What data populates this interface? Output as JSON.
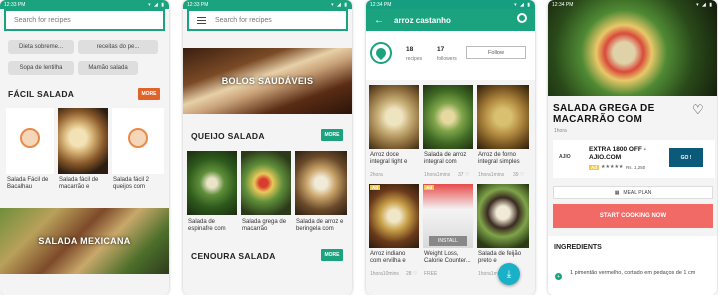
{
  "statusbar": {
    "time": "12:33 PM",
    "time2": "12:34 PM",
    "signal": "▾◢▮"
  },
  "screen1": {
    "search_placeholder": "Search for recipes",
    "chips": [
      "Dieta sobreme...",
      "receitas do pe...",
      "Sopa de lentilha",
      "Mamão salada"
    ],
    "section1_title": "FÁCIL SALADA",
    "more_label": "MORE",
    "items": [
      {
        "caption": "Salada Fácil de Bacalhau"
      },
      {
        "caption": "Salada fácil de macarrão e"
      },
      {
        "caption": "Salada fácil 2 queijos com"
      }
    ],
    "banner_label": "SALADA MEXICANA"
  },
  "screen2": {
    "search_placeholder": "Search for recipes",
    "banner_label": "BOLOS SAUDÁVEIS",
    "section1_title": "QUEIJO SALADA",
    "more_label": "MORE",
    "items": [
      {
        "caption": "Salada de espinafre com"
      },
      {
        "caption": "Salada grega de macarrão"
      },
      {
        "caption": "Salada de arroz e beringela com"
      }
    ],
    "section2_title": "CENOURA SALADA"
  },
  "screen3": {
    "title": "arroz castanho",
    "recipes_count": "18",
    "recipes_label": "recipes",
    "followers_count": "17",
    "followers_label": "followers",
    "follow_label": "Follow",
    "grid": [
      {
        "caption": "Arroz doce integral light e",
        "meta": "2hora",
        "likes": ""
      },
      {
        "caption": "Salada de arroz integral com",
        "meta": "1hora1mins",
        "likes": "37 ♡"
      },
      {
        "caption": "Arroz de forno integral simples",
        "meta": "1hora1mins",
        "likes": "39 ♡"
      },
      {
        "caption": "Arroz indiano com ervilha e",
        "meta": "1hora10mins",
        "likes": "28 ♡",
        "badge": "Ad"
      },
      {
        "caption": "Weight Loss, Calorie Counter...",
        "meta": "FREE",
        "likes": "",
        "install": "INSTALL",
        "badge": "Ad"
      },
      {
        "caption": "Salada de feijão preto e",
        "meta": "1hora1mins",
        "likes": ""
      }
    ]
  },
  "screen4": {
    "title": "SALADA GREGA DE MACARRÃO COM",
    "subtitle": "1hora",
    "ad_title": "EXTRA 1800 OFF - AJIO.COM",
    "ad_price": "Rs. 1,250",
    "ad_brand": "AJIO",
    "ad_button": "GO !",
    "meal_plan": "MEAL PLAN",
    "start_cooking": "START COOKING NOW",
    "ingredients_title": "INGREDIENTS",
    "ingredient1": "1 pimentão vermelho, cortado em pedaços de 1 cm"
  },
  "colors": {
    "green": "#1aa37e",
    "orange": "#e0632a",
    "salmon": "#f26a66"
  }
}
